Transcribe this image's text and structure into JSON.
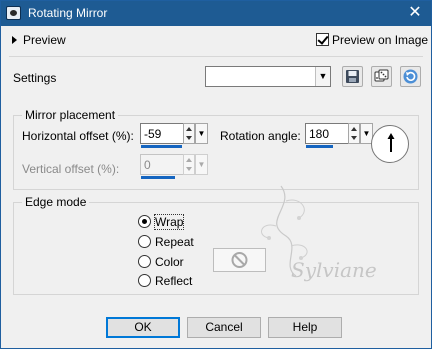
{
  "window": {
    "title": "Rotating Mirror"
  },
  "header": {
    "preview_label": "Preview",
    "preview_on_image_label": "Preview on Image",
    "preview_on_image_checked": true
  },
  "settings": {
    "label": "Settings",
    "preset_value": "",
    "buttons": [
      "save-preset-icon",
      "randomize-icon",
      "reset-icon"
    ]
  },
  "mirror_placement": {
    "title": "Mirror placement",
    "horizontal_offset_label": "Horizontal offset (%):",
    "horizontal_offset_value": "-59",
    "rotation_angle_label": "Rotation angle:",
    "rotation_angle_value": "180",
    "vertical_offset_label": "Vertical offset (%):",
    "vertical_offset_value": "0",
    "vertical_offset_enabled": false
  },
  "edge_mode": {
    "title": "Edge mode",
    "options": [
      "Wrap",
      "Repeat",
      "Color",
      "Reflect"
    ],
    "selected": "Wrap"
  },
  "watermark": {
    "text": "Sylviane"
  },
  "footer": {
    "ok_label": "OK",
    "cancel_label": "Cancel",
    "help_label": "Help"
  },
  "colors": {
    "titlebar": "#1e5b93",
    "accent": "#1565c0",
    "dialog_bg": "#f0f0f0"
  }
}
